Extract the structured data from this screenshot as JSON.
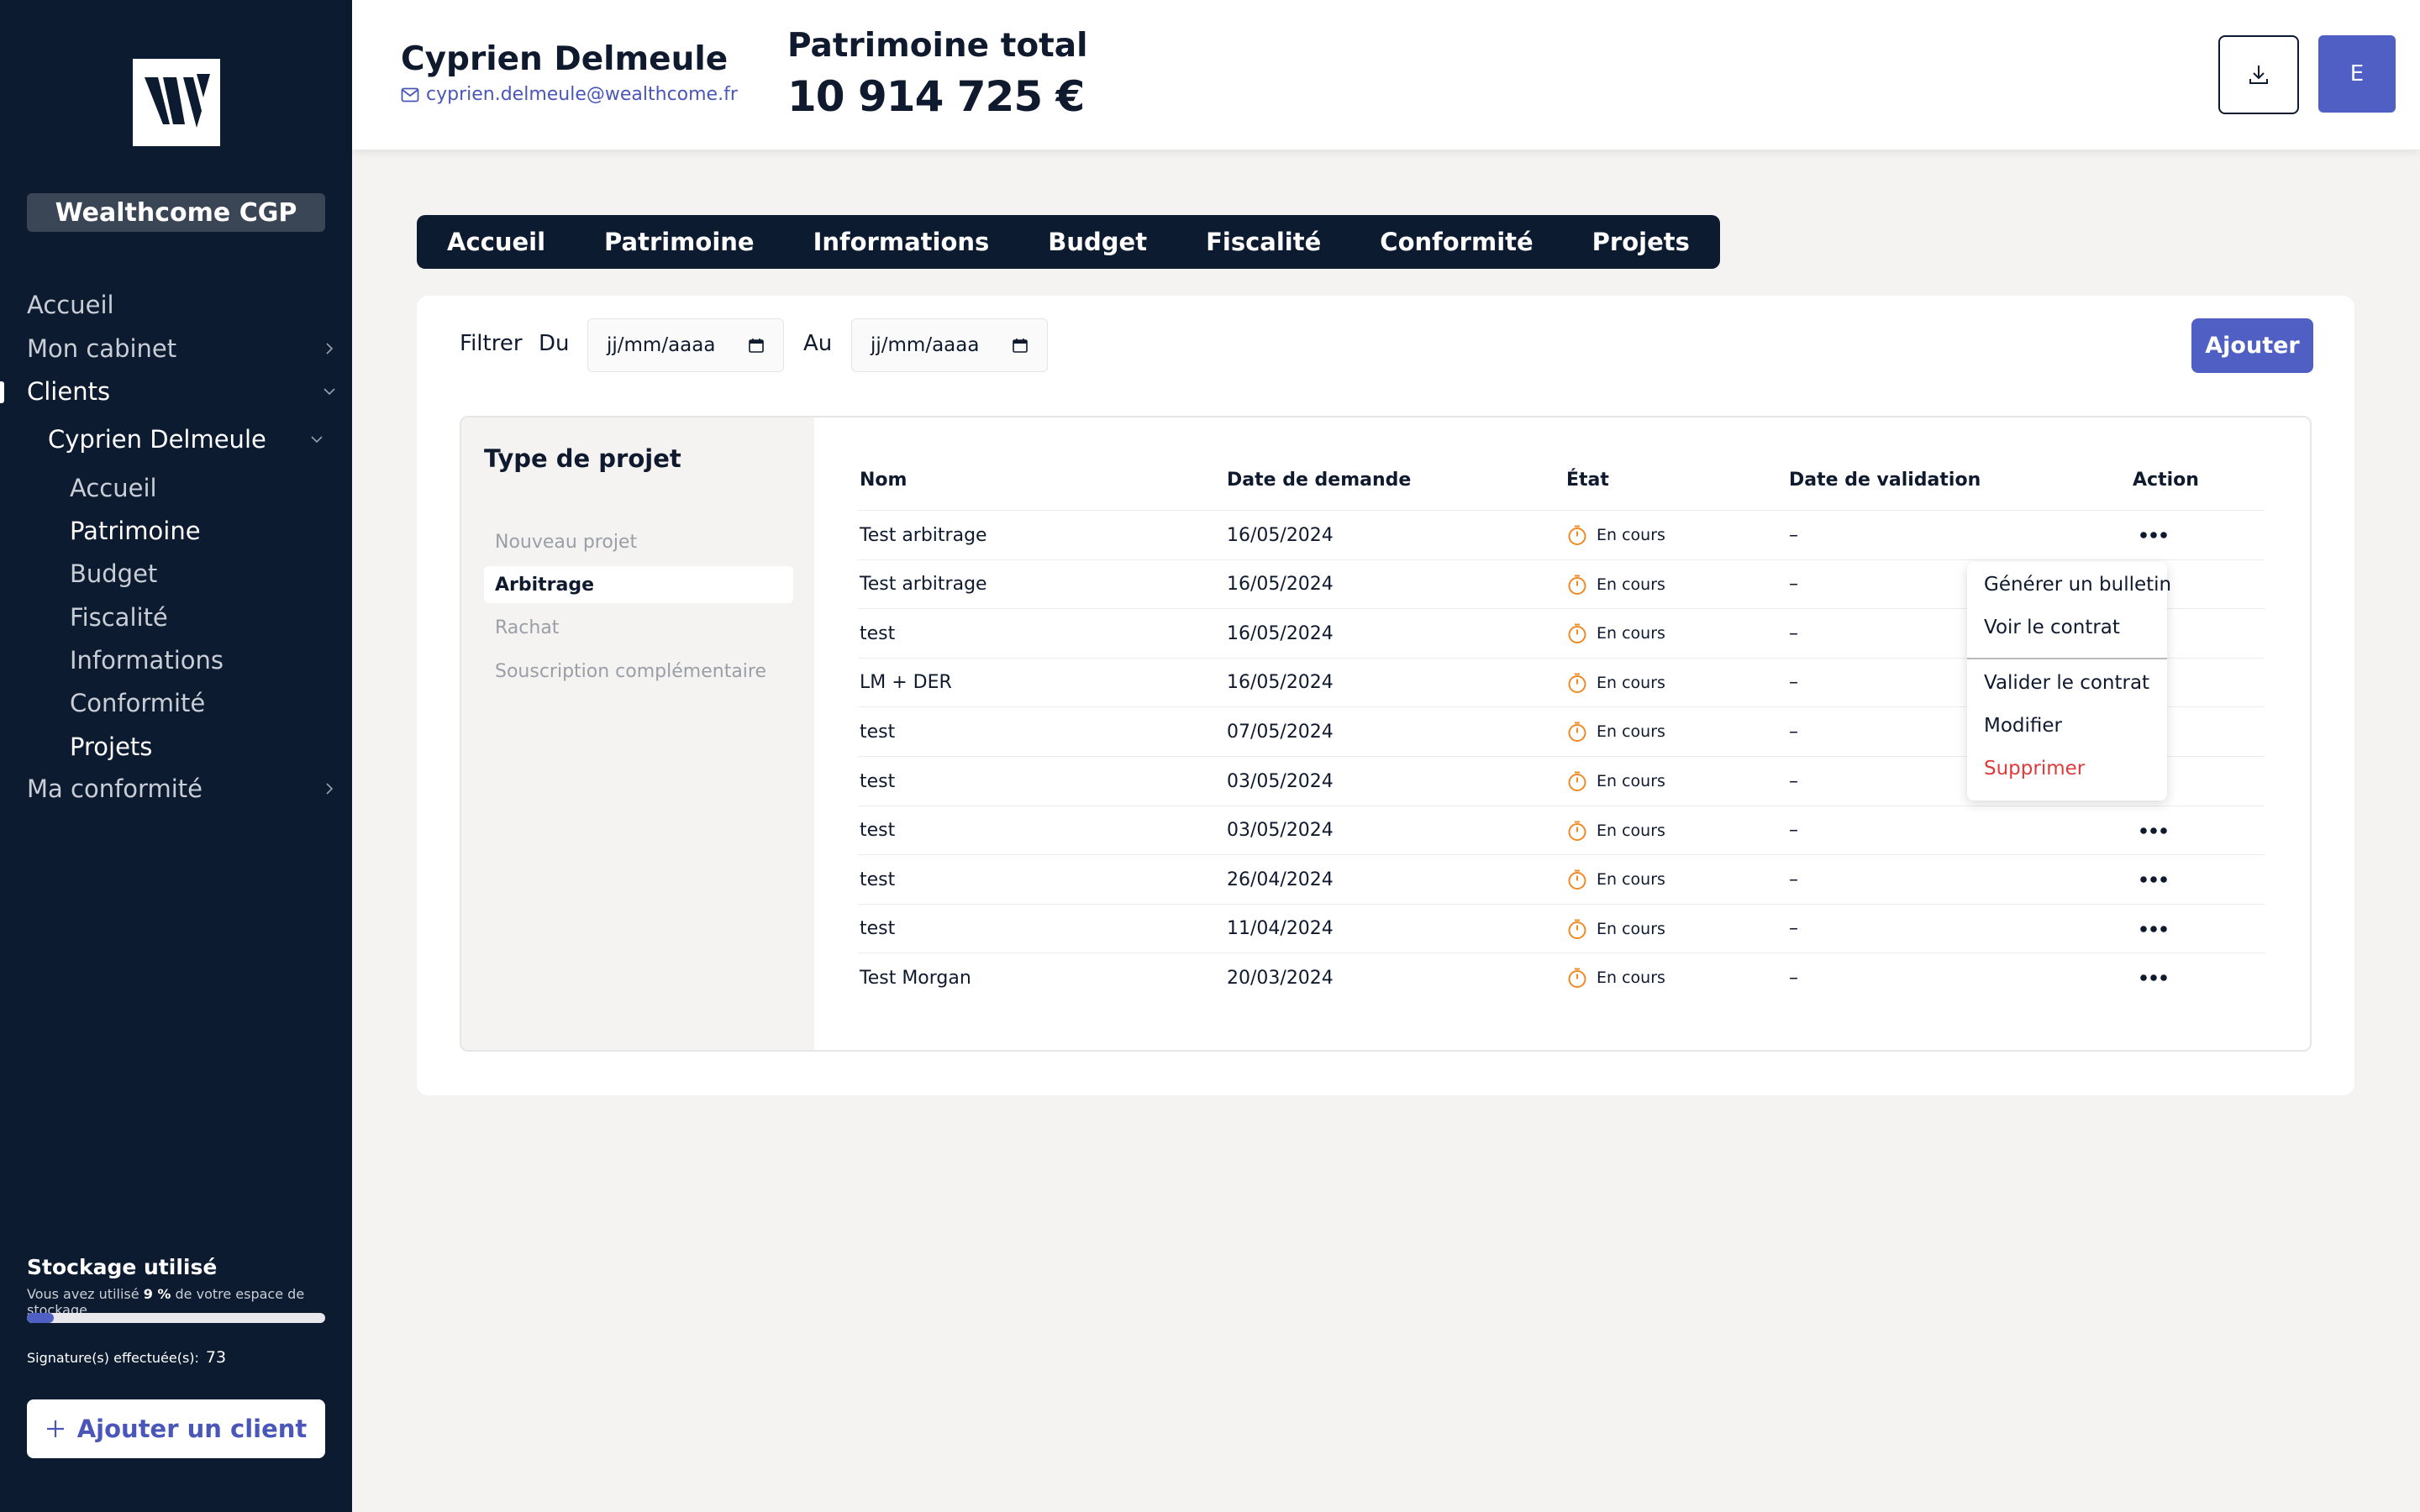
{
  "sidebar": {
    "firm_name": "Wealthcome CGP",
    "nav": [
      {
        "label": "Accueil"
      },
      {
        "label": "Mon cabinet"
      },
      {
        "label": "Clients"
      },
      {
        "label": "Cyprien Delmeule"
      },
      {
        "label": "Accueil"
      },
      {
        "label": "Patrimoine"
      },
      {
        "label": "Budget"
      },
      {
        "label": "Fiscalité"
      },
      {
        "label": "Informations"
      },
      {
        "label": "Conformité"
      },
      {
        "label": "Projets"
      },
      {
        "label": "Ma conformité"
      }
    ],
    "storage": {
      "title": "Stockage utilisé",
      "desc_prefix": "Vous avez utilisé",
      "percent_label": "9 %",
      "desc_suffix": "de votre espace de stockage",
      "percent": 9
    },
    "signatures_label": "Signature(s) effectuée(s):",
    "signatures_value": "73",
    "add_client_label": "Ajouter un client"
  },
  "header": {
    "client_name": "Cyprien Delmeule",
    "client_email": "cyprien.delmeule@wealthcome.fr",
    "patrimoine_label": "Patrimoine total",
    "patrimoine_value": "10 914 725 €",
    "avatar_letter": "E"
  },
  "tabs": [
    "Accueil",
    "Patrimoine",
    "Informations",
    "Budget",
    "Fiscalité",
    "Conformité",
    "Projets"
  ],
  "filter": {
    "label": "Filtrer",
    "from_label": "Du",
    "to_label": "Au",
    "date_placeholder": "jj/mm/aaaa",
    "add_label": "Ajouter"
  },
  "project_types": {
    "title": "Type de projet",
    "items": [
      "Nouveau projet",
      "Arbitrage",
      "Rachat",
      "Souscription complémentaire"
    ],
    "selected": "Arbitrage"
  },
  "table": {
    "headers": [
      "Nom",
      "Date de demande",
      "État",
      "Date de validation",
      "Action"
    ],
    "rows": [
      {
        "nom": "Test arbitrage",
        "date": "16/05/2024",
        "etat": "En cours",
        "validation": "–"
      },
      {
        "nom": "Test arbitrage",
        "date": "16/05/2024",
        "etat": "En cours",
        "validation": "–"
      },
      {
        "nom": "test",
        "date": "16/05/2024",
        "etat": "En cours",
        "validation": "–"
      },
      {
        "nom": "LM + DER",
        "date": "16/05/2024",
        "etat": "En cours",
        "validation": "–"
      },
      {
        "nom": "test",
        "date": "07/05/2024",
        "etat": "En cours",
        "validation": "–"
      },
      {
        "nom": "test",
        "date": "03/05/2024",
        "etat": "En cours",
        "validation": "–"
      },
      {
        "nom": "test",
        "date": "03/05/2024",
        "etat": "En cours",
        "validation": "–"
      },
      {
        "nom": "test",
        "date": "26/04/2024",
        "etat": "En cours",
        "validation": "–"
      },
      {
        "nom": "test",
        "date": "11/04/2024",
        "etat": "En cours",
        "validation": "–"
      },
      {
        "nom": "Test Morgan",
        "date": "20/03/2024",
        "etat": "En cours",
        "validation": "–"
      }
    ]
  },
  "context_menu": {
    "items": [
      "Générer un bulletin",
      "Voir le contrat",
      "Valider le contrat",
      "Modifier",
      "Supprimer"
    ]
  },
  "colors": {
    "sidebar_bg": "#0d1b31",
    "accent": "#4f5fc4",
    "status_orange": "#f08a24",
    "danger": "#e03a3a"
  },
  "icons": [
    "wealthcome-logo-icon",
    "chevron-right-icon",
    "chevron-down-icon",
    "mail-icon",
    "download-icon",
    "calendar-icon",
    "timer-icon",
    "more-horizontal-icon",
    "plus-icon"
  ]
}
